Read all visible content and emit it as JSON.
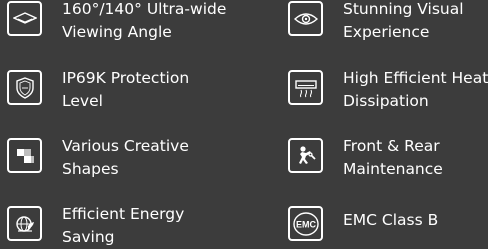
{
  "features": [
    {
      "id": "viewing-angle",
      "icon": "viewing-angle-icon",
      "lines": [
        "160°/140° Ultra-wide",
        "Viewing Angle"
      ]
    },
    {
      "id": "visual-experience",
      "icon": "eye-icon",
      "lines": [
        "Stunning Visual",
        "Experience"
      ]
    },
    {
      "id": "ip69k",
      "icon": "shield-icon",
      "lines": [
        "IP69K Protection",
        "Level"
      ]
    },
    {
      "id": "heat-dissipation",
      "icon": "heat-vent-icon",
      "lines": [
        "High Efficient Heat",
        "Dissipation"
      ]
    },
    {
      "id": "creative-shapes",
      "icon": "shapes-icon",
      "lines": [
        "Various Creative",
        "Shapes"
      ]
    },
    {
      "id": "maintenance",
      "icon": "technician-icon",
      "lines": [
        "Front & Rear",
        "Maintenance"
      ]
    },
    {
      "id": "energy-saving",
      "icon": "globe-leaf-icon",
      "lines": [
        "Efficient Energy",
        "Saving"
      ]
    },
    {
      "id": "emc",
      "icon": "emc-icon",
      "lines": [
        "EMC Class B"
      ],
      "icon_text": "EMC"
    }
  ],
  "colors": {
    "background": "#3c3c3c",
    "foreground": "#ffffff"
  }
}
